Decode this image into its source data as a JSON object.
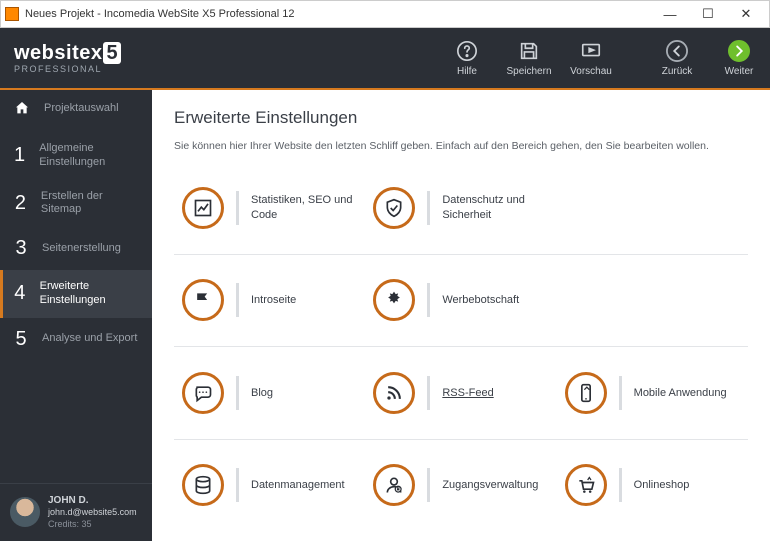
{
  "window": {
    "title": "Neues Projekt - Incomedia WebSite X5 Professional 12"
  },
  "brand": {
    "name_a": "website",
    "name_b": "x",
    "badge": "5",
    "edition": "PROFESSIONAL"
  },
  "toolbar": {
    "help": "Hilfe",
    "save": "Speichern",
    "preview": "Vorschau",
    "back": "Zurück",
    "next": "Weiter"
  },
  "sidebar": {
    "home": "Projektauswahl",
    "steps": [
      {
        "num": "1",
        "label": "Allgemeine Einstellungen"
      },
      {
        "num": "2",
        "label": "Erstellen der Sitemap"
      },
      {
        "num": "3",
        "label": "Seitenerstellung"
      },
      {
        "num": "4",
        "label": "Erweiterte Einstellungen"
      },
      {
        "num": "5",
        "label": "Analyse und Export"
      }
    ]
  },
  "user": {
    "name": "JOHN D.",
    "email": "john.d@website5.com",
    "credits": "Credits: 35"
  },
  "page": {
    "title": "Erweiterte Einstellungen",
    "description": "Sie können hier Ihrer Website den letzten Schliff geben. Einfach auf den  Bereich gehen, den Sie bearbeiten wollen."
  },
  "tiles": [
    [
      {
        "label": "Statistiken, SEO und Code"
      },
      {
        "label": "Datenschutz und Sicherheit"
      },
      null
    ],
    [
      {
        "label": "Introseite"
      },
      {
        "label": "Werbebotschaft"
      },
      null
    ],
    [
      {
        "label": "Blog"
      },
      {
        "label": "RSS-Feed",
        "underline": true
      },
      {
        "label": "Mobile Anwendung"
      }
    ],
    [
      {
        "label": "Datenmanagement"
      },
      {
        "label": "Zugangsverwaltung"
      },
      {
        "label": "Onlineshop"
      }
    ]
  ]
}
